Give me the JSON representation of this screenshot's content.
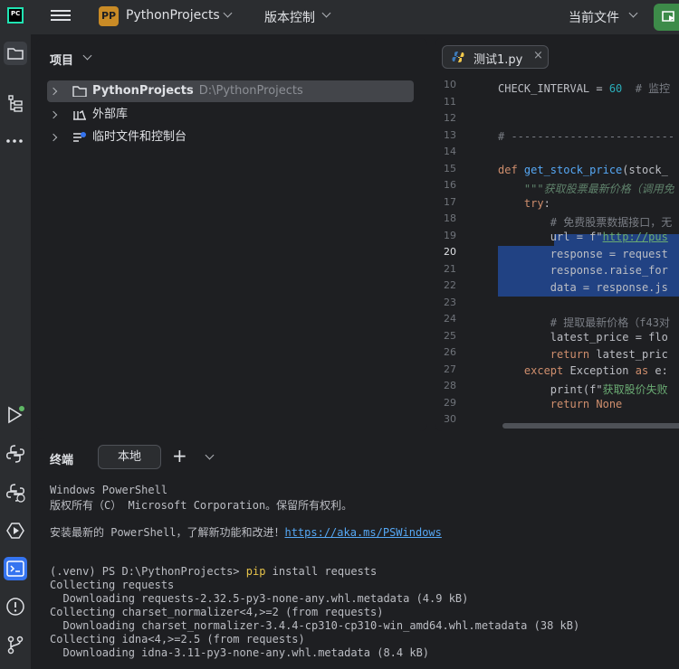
{
  "topbar": {
    "project_badge": "PP",
    "project_name": "PythonProjects",
    "vcs_label": "版本控制",
    "current_file_label": "当前文件"
  },
  "project_panel": {
    "title": "项目",
    "tree": [
      {
        "label": "PythonProjects",
        "path": "D:\\PythonProjects"
      },
      {
        "label": "外部库"
      },
      {
        "label": "临时文件和控制台"
      }
    ]
  },
  "editor": {
    "tab_name": "测试1.py",
    "tab_close": "×",
    "line_numbers": [
      "10",
      "11",
      "12",
      "13",
      "14",
      "15",
      "16",
      "17",
      "18",
      "19",
      "20",
      "21",
      "22",
      "23",
      "24",
      "25",
      "26",
      "27",
      "28",
      "29",
      "30"
    ],
    "lines": {
      "l10a": "CHECK_INTERVAL = ",
      "l10b": "60",
      "l10c": "  # 监控",
      "l13": "# -------------------------",
      "l15a": "def ",
      "l15b": "get_stock_price",
      "l15c": "(stock_",
      "l16": "    \"\"\"获取股票最新价格（调用免",
      "l17a": "    ",
      "l17b": "try",
      "l17c": ":",
      "l18": "        # 免费股票数据接口，无",
      "l19a": "        url = f\"",
      "l19b": "http://pus",
      "l20": "        response = request",
      "l21": "        response.raise_for",
      "l22": "        data = response.js",
      "l24": "        # 提取最新价格（f43对",
      "l25": "        latest_price = flo",
      "l26a": "        ",
      "l26b": "return",
      "l26c": " latest_pric",
      "l27a": "    ",
      "l27b": "except",
      "l27c": " Exception ",
      "l27d": "as",
      "l27e": " e:",
      "l28a": "        print(f\"",
      "l28b": "获取股价失败",
      "l29a": "        ",
      "l29b": "return",
      "l29c": " None"
    }
  },
  "terminal": {
    "title": "终端",
    "tab_label": "本地",
    "plus": "+",
    "output": {
      "o1": "Windows PowerShell",
      "o2": "版权所有（C） Microsoft Corporation。保留所有权利。",
      "o3a": "安装最新的 PowerShell，了解新功能和改进！",
      "o3b": "https://aka.ms/PSWindows",
      "o4a": "(.venv) PS D:\\PythonProjects> ",
      "o4b": "pip",
      "o4c": " install requests",
      "o5": "Collecting requests",
      "o6": "  Downloading requests-2.32.5-py3-none-any.whl.metadata (4.9 kB)",
      "o7": "Collecting charset_normalizer<4,>=2 (from requests)",
      "o8": "  Downloading charset_normalizer-3.4.4-cp310-cp310-win_amd64.whl.metadata (38 kB)",
      "o9": "Collecting idna<4,>=2.5 (from requests)",
      "o10": "  Downloading idna-3.11-py3-none-any.whl.metadata (8.4 kB)"
    }
  }
}
